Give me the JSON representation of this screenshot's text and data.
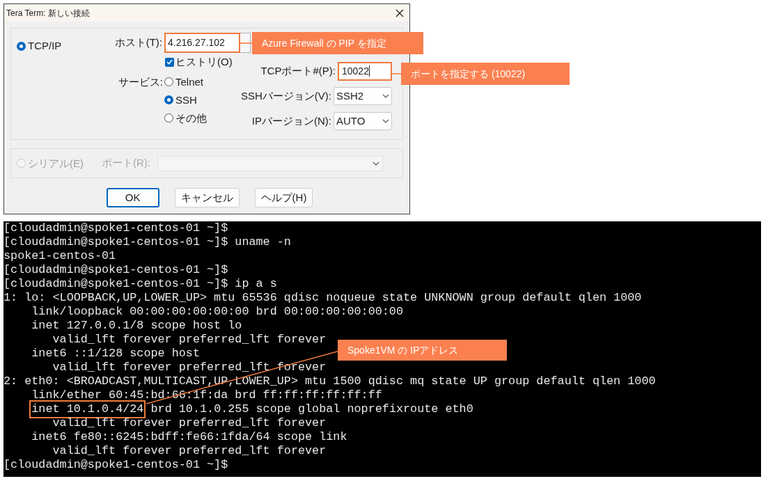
{
  "dialog": {
    "title": "Tera Term: 新しい接続",
    "tcpip": {
      "label": "TCP/IP",
      "selected": true
    },
    "host": {
      "label": "ホスト(T):",
      "value": "4.216.27.102",
      "highlighted": true
    },
    "history": {
      "label": "ヒストリ(O)",
      "checked": true
    },
    "service_label": "サービス:",
    "services": [
      {
        "label": "Telnet",
        "selected": false
      },
      {
        "label": "SSH",
        "selected": true
      },
      {
        "label": "その他",
        "selected": false
      }
    ],
    "tcp_port": {
      "label": "TCPポート#(P):",
      "value": "10022",
      "highlighted": true
    },
    "ssh_version": {
      "label": "SSHバージョン(V):",
      "value": "SSH2"
    },
    "ip_version": {
      "label": "IPバージョン(N):",
      "value": "AUTO"
    },
    "serial": {
      "label": "シリアル(E)",
      "selected": false,
      "disabled": true
    },
    "port": {
      "label": "ポート(R):",
      "disabled": true
    },
    "buttons": [
      {
        "label": "OK",
        "default": true
      },
      {
        "label": "キャンセル",
        "default": false
      },
      {
        "label": "ヘルプ(H)",
        "default": false
      }
    ]
  },
  "terminal": {
    "lines": [
      {
        "text": "[cloudadmin@spoke1-centos-01 ~]$"
      },
      {
        "text": "[cloudadmin@spoke1-centos-01 ~]$ uname -n"
      },
      {
        "text": "spoke1-centos-01"
      },
      {
        "text": "[cloudadmin@spoke1-centos-01 ~]$"
      },
      {
        "text": "[cloudadmin@spoke1-centos-01 ~]$ ip a s"
      },
      {
        "text": "1: lo: <LOOPBACK,UP,LOWER_UP> mtu 65536 qdisc noqueue state UNKNOWN group default qlen 1000"
      },
      {
        "text": "    link/loopback 00:00:00:00:00:00 brd 00:00:00:00:00:00"
      },
      {
        "text": "    inet 127.0.0.1/8 scope host lo"
      },
      {
        "text": "       valid_lft forever preferred_lft forever"
      },
      {
        "text": "    inet6 ::1/128 scope host"
      },
      {
        "text": "       valid_lft forever preferred_lft forever"
      },
      {
        "text": "2: eth0: <BROADCAST,MULTICAST,UP,LOWER_UP> mtu 1500 qdisc mq state UP group default qlen 1000"
      },
      {
        "text": "    link/ether 60:45:bd:66:1f:da brd ff:ff:ff:ff:ff:ff"
      },
      {
        "highlighted": "inet 10.1.0.4/24",
        "text": " brd 10.1.0.255 scope global noprefixroute eth0"
      },
      {
        "text": "       valid_lft forever preferred_lft forever"
      },
      {
        "text": "    inet6 fe80::6245:bdff:fe66:1fda/64 scope link"
      },
      {
        "text": "       valid_lft forever preferred_lft forever"
      },
      {
        "text": "[cloudadmin@spoke1-centos-01 ~]$"
      }
    ]
  },
  "callouts": [
    {
      "text": "Azure Firewall の PIP を指定"
    },
    {
      "text": "ポートを指定する (10022)"
    },
    {
      "text": "Spoke1VM の IPアドレス"
    }
  ]
}
